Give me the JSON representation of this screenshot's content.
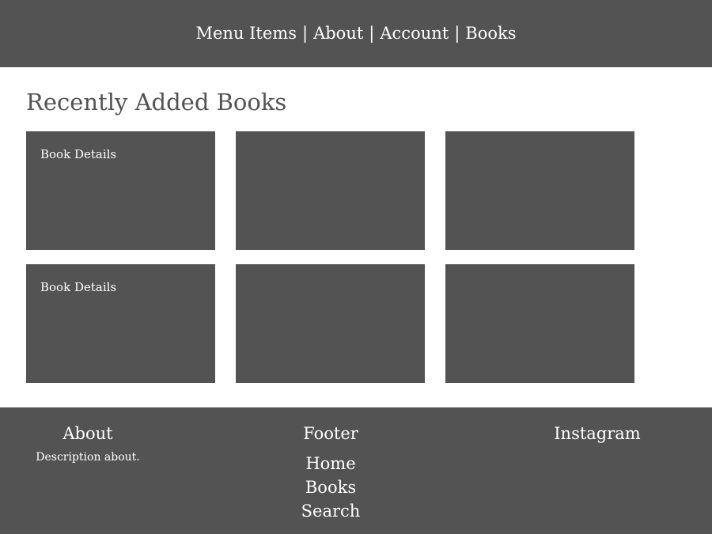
{
  "header": {
    "nav": [
      "Menu Items",
      "About",
      "Account",
      "Books"
    ],
    "separator": "|"
  },
  "main": {
    "title": "Recently Added Books",
    "cards": [
      {
        "label": "Book Details"
      },
      {
        "label": ""
      },
      {
        "label": ""
      },
      {
        "label": "Book Details"
      },
      {
        "label": ""
      },
      {
        "label": ""
      }
    ]
  },
  "footer": {
    "about": {
      "heading": "About",
      "description": "Description about."
    },
    "center": {
      "heading": "Footer",
      "links": [
        "Home",
        "Books",
        "Search"
      ]
    },
    "instagram": {
      "heading": "Instagram"
    }
  },
  "colors": {
    "dark": "#535353",
    "light": "#ffffff"
  }
}
